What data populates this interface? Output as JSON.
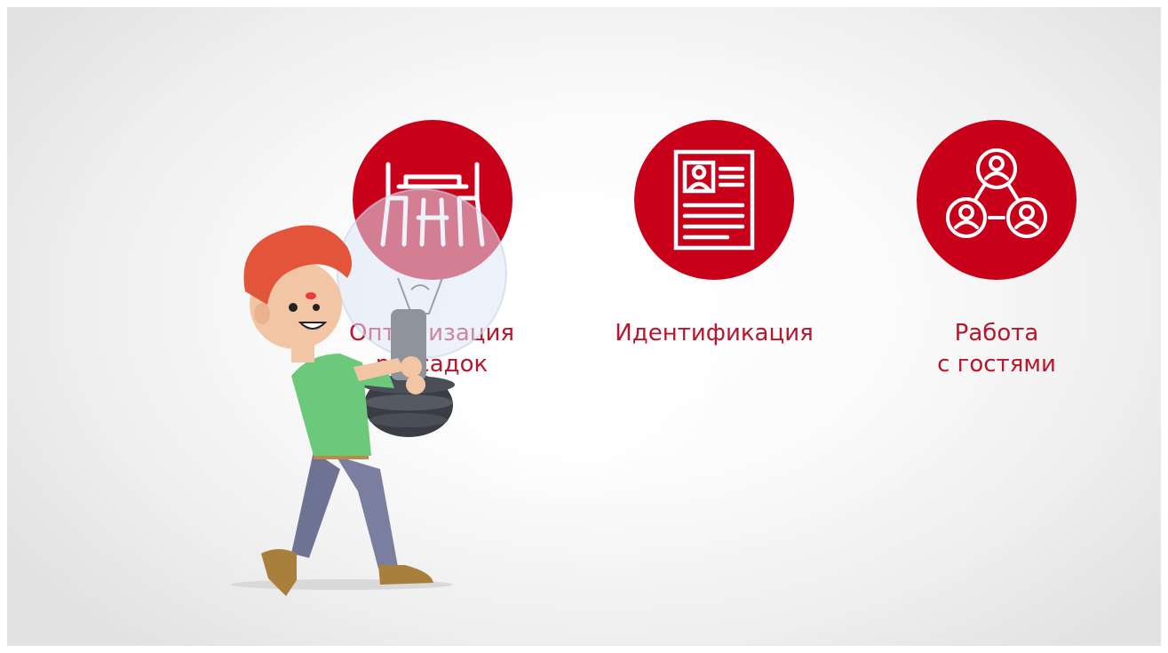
{
  "features": [
    {
      "label": "Оптимизация\nрассадок",
      "icon": "table-chairs-icon"
    },
    {
      "label": "Идентификация",
      "icon": "id-card-icon"
    },
    {
      "label": "Работа\nс гостями",
      "icon": "people-network-icon"
    }
  ],
  "colors": {
    "accent": "#c8001a",
    "label_text": "#b8162c",
    "background": "#f2f2f2"
  }
}
